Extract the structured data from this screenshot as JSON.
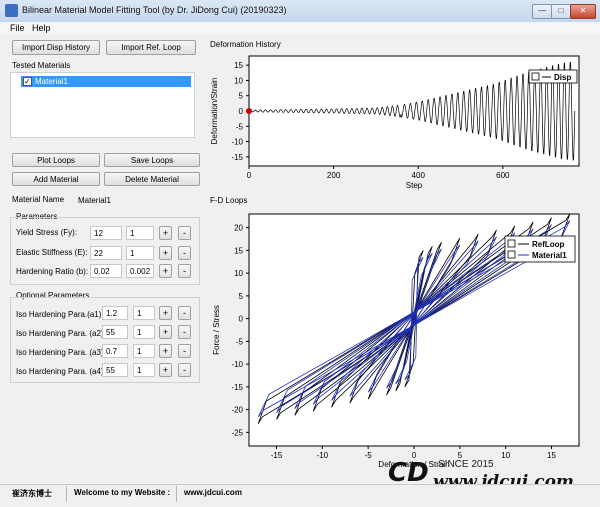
{
  "window": {
    "title": "Bilinear Material Model Fitting Tool (by Dr. JiDong Cui) (20190323)",
    "min_glyph": "—",
    "max_glyph": "□",
    "close_glyph": "✕"
  },
  "menu": [
    "File",
    "Help"
  ],
  "toolbar": {
    "import_disp": "Import Disp History",
    "import_ref": "Import Ref. Loop"
  },
  "tested_materials": {
    "label": "Tested Materials",
    "items": [
      {
        "name": "Material1",
        "checked": true,
        "check_glyph": "✓"
      }
    ]
  },
  "actions": {
    "plot_loops": "Plot Loops",
    "save_loops": "Save Loops",
    "add_material": "Add Material",
    "delete_material": "Delete Material"
  },
  "material_name": {
    "label": "Material Name",
    "value": "Material1"
  },
  "parameters": {
    "label": "Parameters",
    "rows": [
      {
        "label": "Yield Stress (Fy):",
        "value": "12",
        "step": "1"
      },
      {
        "label": "Elastic Stiffness (E):",
        "value": "22",
        "step": "1"
      },
      {
        "label": "Hardening Ratio (b):",
        "value": "0.02",
        "step": "0.002"
      }
    ]
  },
  "optional_parameters": {
    "label": "Optional Parameters",
    "rows": [
      {
        "label": "Iso Hardening Para.(a1):",
        "value": "1.2",
        "step": "1"
      },
      {
        "label": "Iso Hardening Para. (a2):",
        "value": "55",
        "step": "1"
      },
      {
        "label": "Iso Hardening Para. (a3):",
        "value": "0.7",
        "step": "1"
      },
      {
        "label": "Iso Hardening Para. (a4):",
        "value": "55",
        "step": "1"
      }
    ]
  },
  "buttons": {
    "plus": "+",
    "minus": "-"
  },
  "charts": {
    "deformation_history": {
      "panel_label": "Deformation History"
    },
    "fd_loops": {
      "panel_label": "F-D Loops"
    }
  },
  "chart_data": [
    {
      "type": "line",
      "xlabel": "Step",
      "ylabel": "Deformation/Strain",
      "xlim": [
        0,
        780
      ],
      "ylim": [
        -18,
        18
      ],
      "xticks": [
        0,
        200,
        400,
        600
      ],
      "yticks": [
        15,
        10,
        5,
        0,
        -5,
        -10,
        -15
      ],
      "legend": {
        "position": "top-right",
        "entries": [
          "Disp"
        ]
      },
      "series": [
        {
          "name": "Disp",
          "color": "#000000",
          "description_points": {
            "x": [
              0,
              100,
              200,
              300,
              360,
              400,
              460,
              520,
              580,
              620,
              660,
              700,
              740,
              770
            ],
            "amplitude": [
              0.3,
              0.5,
              0.7,
              1.0,
              2.0,
              3.0,
              5.0,
              7.0,
              9.0,
              11.0,
              13.0,
              14.5,
              16.0,
              16.5
            ]
          }
        }
      ],
      "marker_start": {
        "x": 0,
        "y": 0,
        "color": "#cc0000"
      }
    },
    {
      "type": "line",
      "xlabel": "Deformation / Strain",
      "ylabel": "Force  /  Stress",
      "xlim": [
        -18,
        18
      ],
      "ylim": [
        -28,
        23
      ],
      "xticks": [
        -15,
        -10,
        -5,
        0,
        5,
        10,
        15
      ],
      "yticks": [
        20,
        15,
        10,
        5,
        0,
        -5,
        -10,
        -15,
        -20,
        -25
      ],
      "legend": {
        "position": "top-right",
        "entries": [
          "RefLoop",
          "Material1"
        ]
      },
      "series": [
        {
          "name": "RefLoop",
          "color": "#000000",
          "amplitudes": [
            1,
            2,
            3,
            5,
            7,
            9,
            11,
            13,
            15,
            17
          ],
          "yield": 13
        },
        {
          "name": "Material1",
          "color": "#2030c0",
          "amplitudes": [
            1,
            2,
            3,
            5,
            7,
            9,
            11,
            13,
            15,
            17
          ],
          "yield": 12
        }
      ]
    }
  ],
  "watermark": {
    "logo": "CD",
    "since": "SINCE 2015",
    "url": "www.jdcui.com"
  },
  "status": {
    "author": "崔济东博士",
    "welcome": "Welcome to my Website :",
    "site": "www.jdcui.com"
  }
}
